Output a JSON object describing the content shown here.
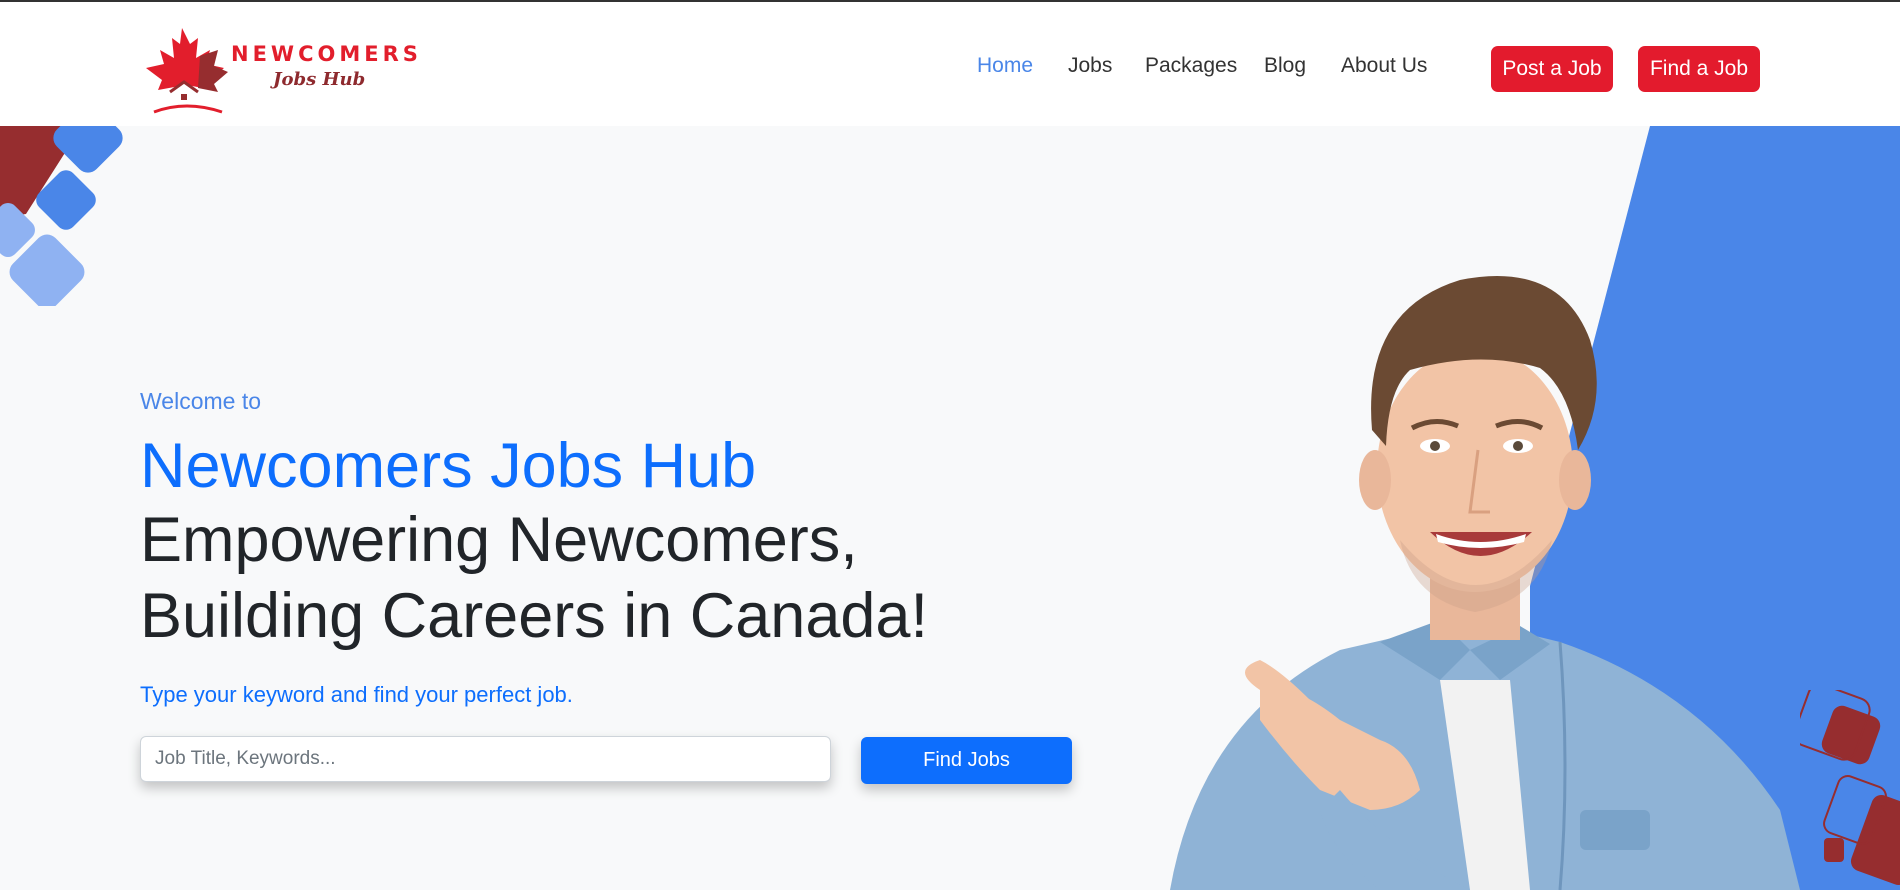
{
  "brand": {
    "name_line1": "NEWCOMERS",
    "name_line2": "Jobs Hub"
  },
  "nav": {
    "items": [
      {
        "label": "Home",
        "active": true
      },
      {
        "label": "Jobs",
        "active": false
      },
      {
        "label": "Packages",
        "active": false
      },
      {
        "label": "Blog",
        "active": false
      },
      {
        "label": "About Us",
        "active": false
      }
    ]
  },
  "header_actions": {
    "post_job": "Post a Job",
    "find_job": "Find a Job"
  },
  "hero": {
    "welcome": "Welcome to",
    "title": "Newcomers Jobs Hub",
    "headline_line1": "Empowering Newcomers,",
    "headline_line2": "Building Careers in Canada!",
    "subtitle": "Type your keyword and find your perfect job."
  },
  "search": {
    "placeholder": "Job Title, Keywords...",
    "value": "",
    "button_label": "Find Jobs"
  },
  "colors": {
    "accent_blue": "#0d6efd",
    "nav_active": "#4a86e8",
    "brand_red": "#e31b2d",
    "dark_red": "#962d2f"
  }
}
